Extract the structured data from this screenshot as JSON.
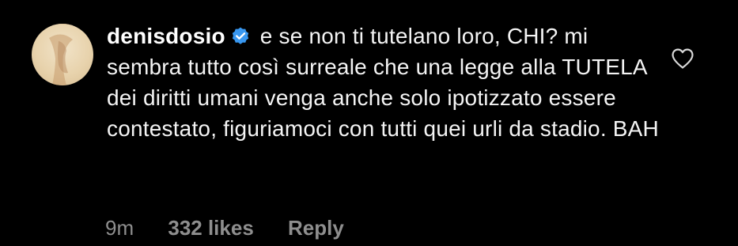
{
  "comment": {
    "username": "denisdosio",
    "text": "e se non ti tutelano loro, CHI? mi sembra tutto così surreale che una legge alla TUTELA dei diritti umani venga anche solo ipotizzato essere contestato, figuriamoci con tutti quei urli da stadio. BAH",
    "time": "9m",
    "likes": "332 likes",
    "reply_label": "Reply"
  },
  "icons": {
    "verified": "verified-badge-icon",
    "like": "heart-outline-icon"
  },
  "colors": {
    "background": "#000000",
    "text": "#ffffff",
    "meta": "#8e8e8e",
    "verified": "#3897f0"
  }
}
